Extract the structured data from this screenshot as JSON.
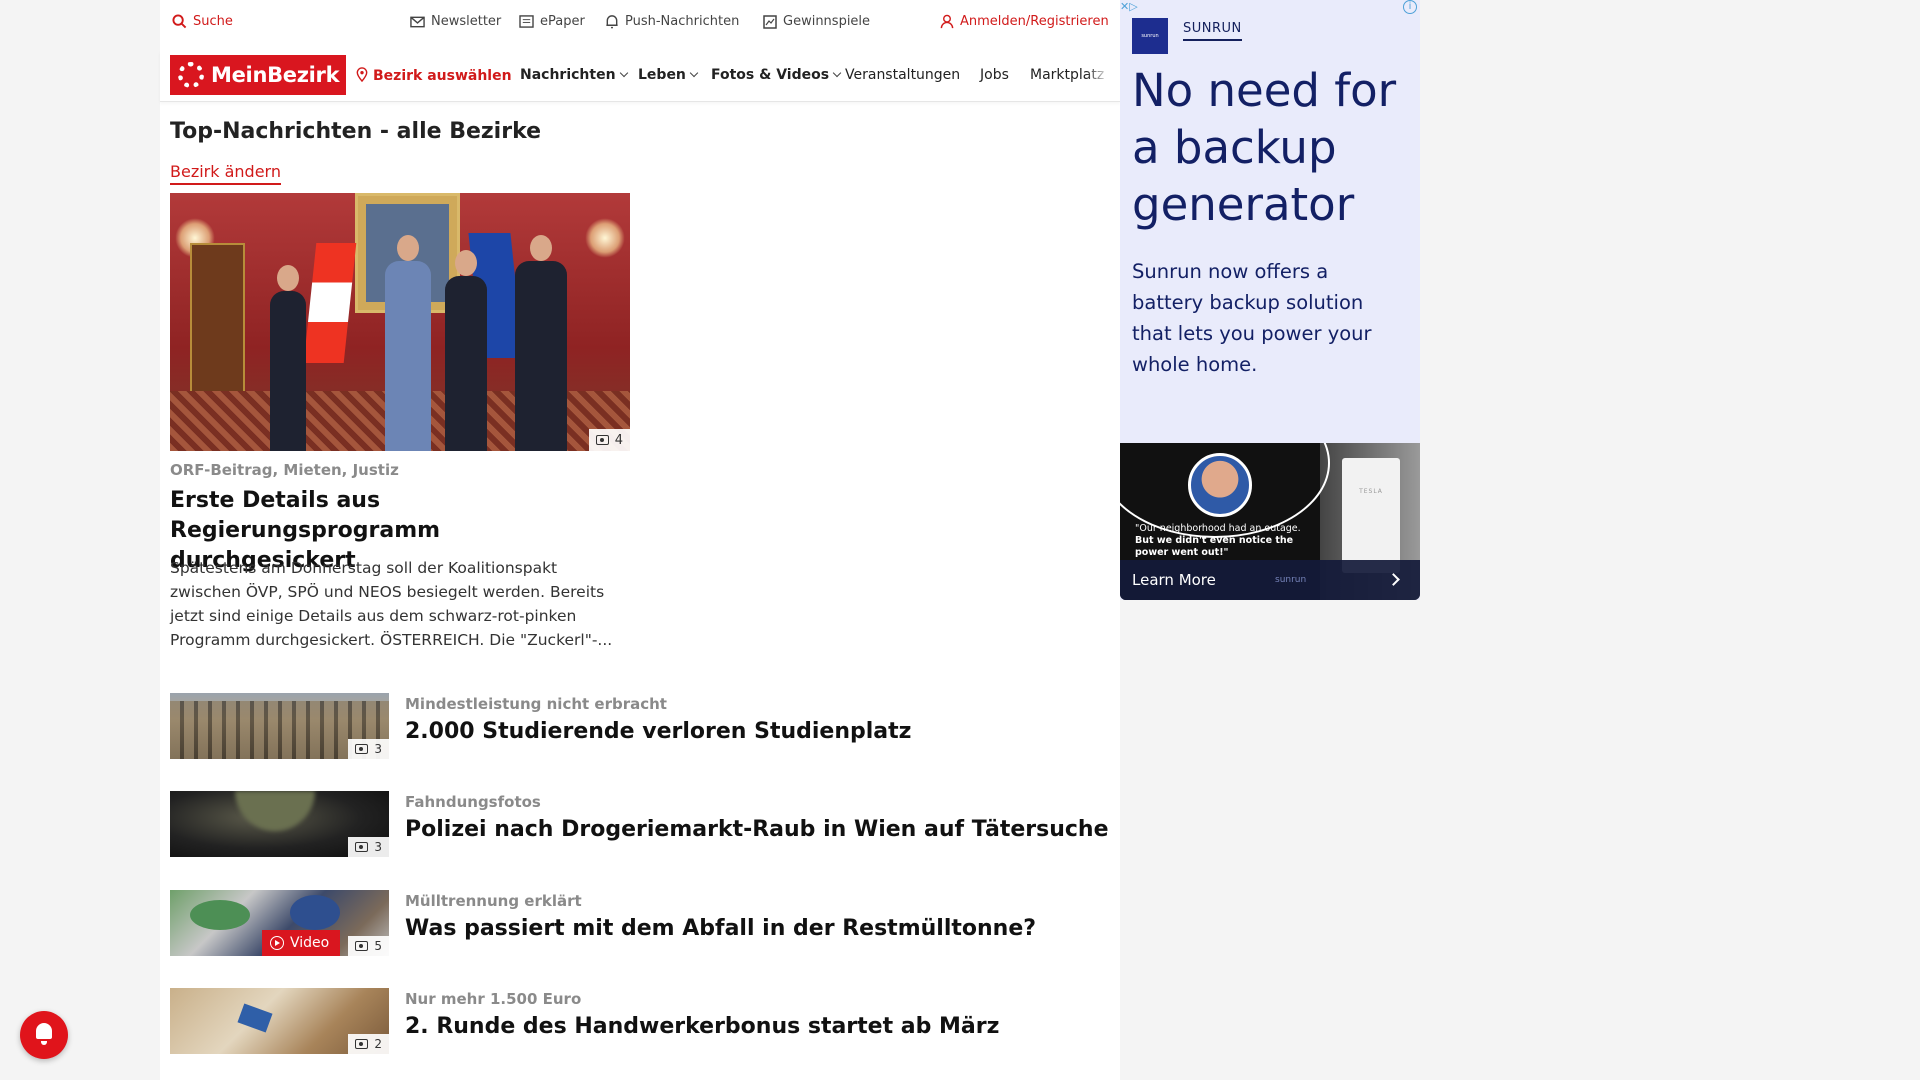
{
  "utility_bar": {
    "search_label": "Suche",
    "newsletter_label": "Newsletter",
    "epaper_label": "ePaper",
    "push_label": "Push-Nachrichten",
    "contests_label": "Gewinnspiele",
    "login_label": "Anmelden/Registrieren"
  },
  "nav": {
    "logo_text": "MeinBezirk",
    "district_select_label": "Bezirk auswählen",
    "items": [
      {
        "label": "Nachrichten"
      },
      {
        "label": "Leben"
      },
      {
        "label": "Fotos & Videos"
      },
      {
        "label": "Veranstaltungen"
      },
      {
        "label": "Jobs"
      },
      {
        "label": "Marktplatz"
      }
    ]
  },
  "section": {
    "title": "Top-Nachrichten - alle Bezirke",
    "change_district_link": "Bezirk ändern"
  },
  "lead_article": {
    "image_count": "4",
    "kicker": "ORF-Beitrag, Mieten, Justiz",
    "title": "Erste Details aus Regierungsprogramm durchgesickert",
    "teaser": "Spätestens am Donnerstag soll der Koalitionspakt zwischen ÖVP, SPÖ und NEOS besiegelt werden. Bereits jetzt sind einige Details aus dem schwarz-rot-pinken Programm durchgesickert.  ÖSTERREICH. Die \"Zuckerl\"-..."
  },
  "articles": [
    {
      "kicker": "Mindestleistung nicht erbracht",
      "title": "2.000 Studierende verloren Studienplatz",
      "image_count": "3"
    },
    {
      "kicker": "Fahndungsfotos",
      "title": "Polizei nach Drogeriemarkt-Raub in Wien auf Tätersuche",
      "image_count": "3"
    },
    {
      "kicker": "Mülltrennung erklärt",
      "title": "Was passiert mit dem Abfall in der Restmülltonne?",
      "image_count": "5",
      "video_label": "Video"
    },
    {
      "kicker": "Nur mehr 1.500 Euro",
      "title": "2. Runde des Handwerkerbonus startet ab März",
      "image_count": "2"
    }
  ],
  "ad": {
    "brand": "SUNRUN",
    "headline": "No need for a backup generator",
    "subtext": "Sunrun now offers a battery backup solution that lets you power your whole home.",
    "quote_line1": "\"Our neighborhood had an outage.",
    "quote_line2": "But we didn't even notice the power went out!\"",
    "cta": "Learn More",
    "small_brand": "sunrun"
  },
  "colors": {
    "brand_red": "#d9161f",
    "ad_background": "#e9ebfb",
    "ad_text": "#132065"
  }
}
